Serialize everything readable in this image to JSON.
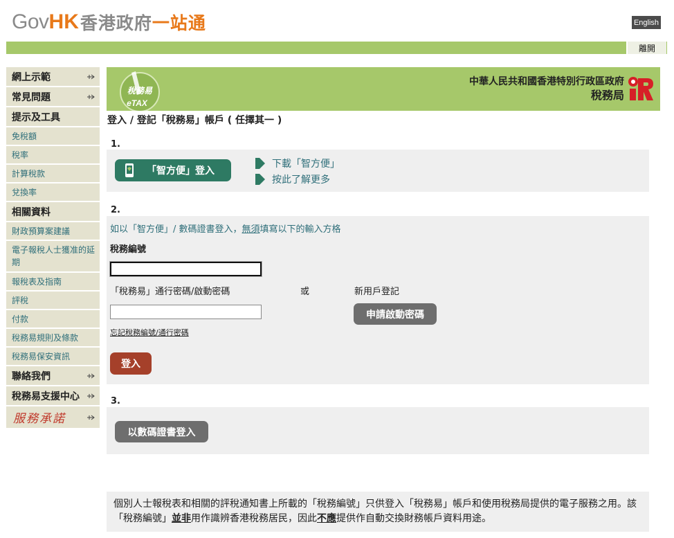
{
  "header": {
    "logo_gov": "Gov",
    "logo_hk": "HK",
    "logo_zh_grey": "香港政府",
    "logo_zh_orange": "一站通",
    "english_label": "English",
    "leave_label": "離開"
  },
  "sidebar": {
    "items": [
      {
        "label": "網上示範",
        "type": "main"
      },
      {
        "label": "常見問題",
        "type": "main"
      },
      {
        "label": "提示及工具",
        "type": "main"
      },
      {
        "label": "免稅額",
        "type": "sub"
      },
      {
        "label": "稅率",
        "type": "sub"
      },
      {
        "label": "計算稅款",
        "type": "sub"
      },
      {
        "label": "兌換率",
        "type": "sub"
      },
      {
        "label": "相關資料",
        "type": "main"
      },
      {
        "label": "財政預算案建議",
        "type": "sub"
      },
      {
        "label": "電子報稅人士獲准的延期",
        "type": "sub"
      },
      {
        "label": "報稅表及指南",
        "type": "sub"
      },
      {
        "label": "評稅",
        "type": "sub"
      },
      {
        "label": "付款",
        "type": "sub"
      },
      {
        "label": "稅務易規則及條款",
        "type": "sub"
      },
      {
        "label": "稅務易保安資訊",
        "type": "sub"
      },
      {
        "label": "聯絡我們",
        "type": "main"
      },
      {
        "label": "稅務易支援中心",
        "type": "main"
      },
      {
        "label": "服務承諾",
        "type": "promise"
      }
    ]
  },
  "banner": {
    "etax_zh": "稅務易",
    "etax_en": "eTAX",
    "dept_line1": "中華人民共和國香港特別行政區政府",
    "dept_line2": "稅務局",
    "ir_logo": "IR"
  },
  "page_heading": "登入 / 登記「稅務易」帳戶 ( 任擇其一 )",
  "section1": {
    "number": "1.",
    "iam_button": "「智方便」登入",
    "link_download": "下載「智方便」",
    "link_more": "按此了解更多"
  },
  "section2": {
    "number": "2.",
    "note_prefix": "如以「智方便」/ 數碼證書登入，",
    "note_underline": "無須",
    "note_suffix": "填寫以下的輸入方格",
    "tax_no_label": "稅務編號",
    "tax_no_value": "",
    "password_label": "「稅務易」通行密碼/啟動密碼",
    "password_value": "",
    "or_label": "或",
    "new_user_label": "新用戶登記",
    "apply_button": "申請啟動密碼",
    "forgot_link": "忘記稅務編號/通行密碼",
    "login_button": "登入"
  },
  "section3": {
    "number": "3.",
    "cert_button": "以數碼證書登入"
  },
  "notice": {
    "part1": "個別人士報稅表和相關的評稅通知書上所載的「稅務編號」只供登入「稅務易」帳戶和使用稅務局提供的電子服務之用。該「稅務編號」",
    "bold1": "並非",
    "part2": "用作識辨香港稅務居民，因此",
    "bold2": "不應",
    "part3": "提供作自動交換財務帳戶資料用途。"
  },
  "colors": {
    "accent_green": "#a6c86a",
    "button_teal": "#2e7a63",
    "button_red": "#a5402a",
    "button_grey": "#6e6e6e",
    "link_teal": "#2f6f7a",
    "logo_orange": "#e8791a"
  }
}
